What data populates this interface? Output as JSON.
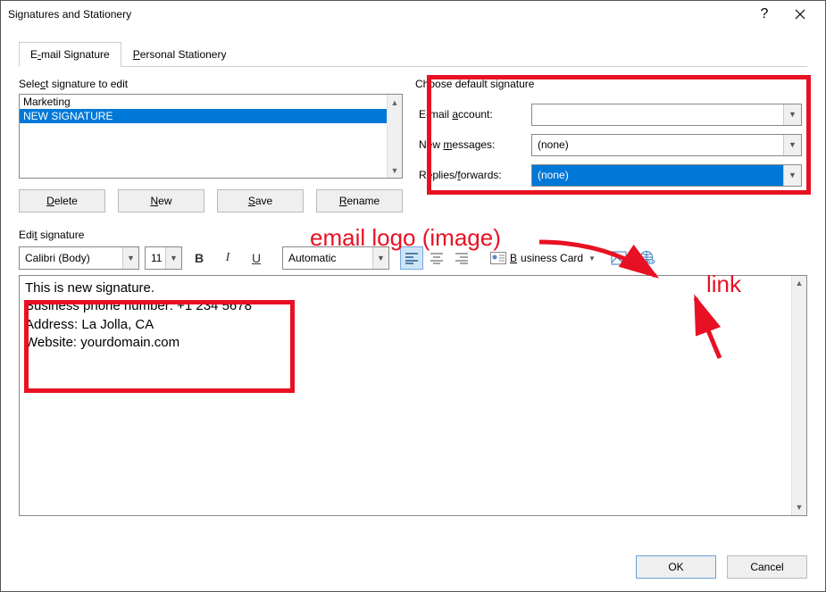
{
  "titlebar": {
    "title": "Signatures and Stationery"
  },
  "tabs": {
    "email_pre": "E",
    "email_ul": "-",
    "email_post": "mail Signature",
    "stationery_pre": "",
    "stationery_ul": "P",
    "stationery_post": "ersonal Stationery"
  },
  "select_label_pre": "Sele",
  "select_label_ul": "c",
  "select_label_post": "t signature to edit",
  "signatures": {
    "item0": "Marketing",
    "item1": "NEW SIGNATURE"
  },
  "buttons": {
    "delete_ul": "D",
    "delete_post": "elete",
    "new_ul": "N",
    "new_post": "ew",
    "save_ul": "S",
    "save_post": "ave",
    "rename_ul": "R",
    "rename_post": "ename"
  },
  "defaults": {
    "heading": "Choose default signature",
    "acct_pre": "E-mail ",
    "acct_ul": "a",
    "acct_post": "ccount:",
    "newmsg_pre": "New ",
    "newmsg_ul": "m",
    "newmsg_post": "essages:",
    "fwd_pre": "Replies/",
    "fwd_ul": "f",
    "fwd_post": "orwards:",
    "acct_val": "",
    "newmsg_val": "(none)",
    "fwd_val": "(none)"
  },
  "edit_label_pre": "Edi",
  "edit_label_ul": "t",
  "edit_label_post": " signature",
  "toolbar": {
    "font": "Calibri (Body)",
    "size": "11",
    "bold": "B",
    "italic": "I",
    "underline": "U",
    "color": "Automatic",
    "biz_ul": "B",
    "biz_post": "usiness Card"
  },
  "editor": {
    "line1": "This is new signature.",
    "line2": "Business phone number: +1 234 5678",
    "line3": "Address: La Jolla, CA",
    "line4": "Website: yourdomain.com"
  },
  "footer": {
    "ok": "OK",
    "cancel": "Cancel"
  },
  "annotations": {
    "imglabel": "email logo (image)",
    "linklabel": "link"
  }
}
